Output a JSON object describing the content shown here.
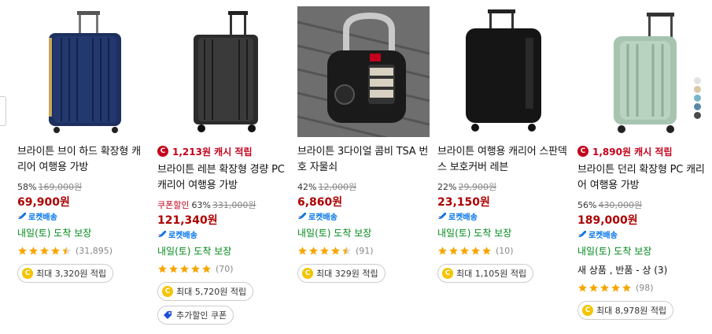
{
  "products": [
    {
      "title": "브라이튼 브이 하드 확장형 캐리어 여행용 가방",
      "discount": "58%",
      "original_price": "169,000원",
      "price": "69,900원",
      "rocket_label": "로켓배송",
      "delivery": "내일(토) 도착 보장",
      "rating_stars": 4.5,
      "review_count": "(31,895)",
      "reward": "최대 3,320원 적립"
    },
    {
      "cashback": "1,213원 캐시 적립",
      "title": "브라이튼 레븐 확장형 경량 PC 캐리어 여행용 가방",
      "coupon_label": "쿠폰할인",
      "discount": "63%",
      "original_price": "331,000원",
      "price": "121,340원",
      "rocket_label": "로켓배송",
      "delivery": "내일(토) 도착 보장",
      "rating_stars": 5,
      "review_count": "(70)",
      "reward": "최대 5,720원 적립",
      "extra_coupon": "추가할인 쿠폰"
    },
    {
      "title": "브라이튼 3다이얼 콤비 TSA 번호 자물쇠",
      "discount": "42%",
      "original_price": "12,000원",
      "price": "6,860원",
      "rocket_label": "로켓배송",
      "delivery": "내일(토) 도착 보장",
      "rating_stars": 4.5,
      "review_count": "(91)",
      "reward": "최대 329원 적립"
    },
    {
      "title": "브라이튼 여행용 캐리어 스판덱스 보호커버 레븐",
      "discount": "22%",
      "original_price": "29,900원",
      "price": "23,150원",
      "rocket_label": "로켓배송",
      "delivery": "내일(토) 도착 보장",
      "rating_stars": 5,
      "review_count": "(10)",
      "reward": "최대 1,105원 적립"
    },
    {
      "cashback": "1,890원 캐시 적립",
      "title": "브라이튼 던리 확장형 PC 캐리어 여행용 가방",
      "discount": "56%",
      "original_price": "430,000원",
      "price": "189,000원",
      "rocket_label": "로켓배송",
      "delivery": "내일(토) 도착 보장",
      "used_info": "새 상품 , 반품 - 상 (3)",
      "rating_stars": 5,
      "review_count": "(98)",
      "reward": "최대 8,978원 적립"
    }
  ],
  "color_swatches": [
    "#e2e2e2",
    "#d9c7a8",
    "#7ab4c9",
    "#5a87a6",
    "#4a4a4a"
  ],
  "colors": {
    "price": "#ae0000",
    "rocket": "#0073e9",
    "delivery": "#00891a",
    "star": "#f7a600"
  },
  "icons": [
    "cash-c-icon",
    "rocket-icon",
    "star-icon",
    "coin-icon",
    "coupon-tag-icon",
    "left-arrow-icon"
  ]
}
